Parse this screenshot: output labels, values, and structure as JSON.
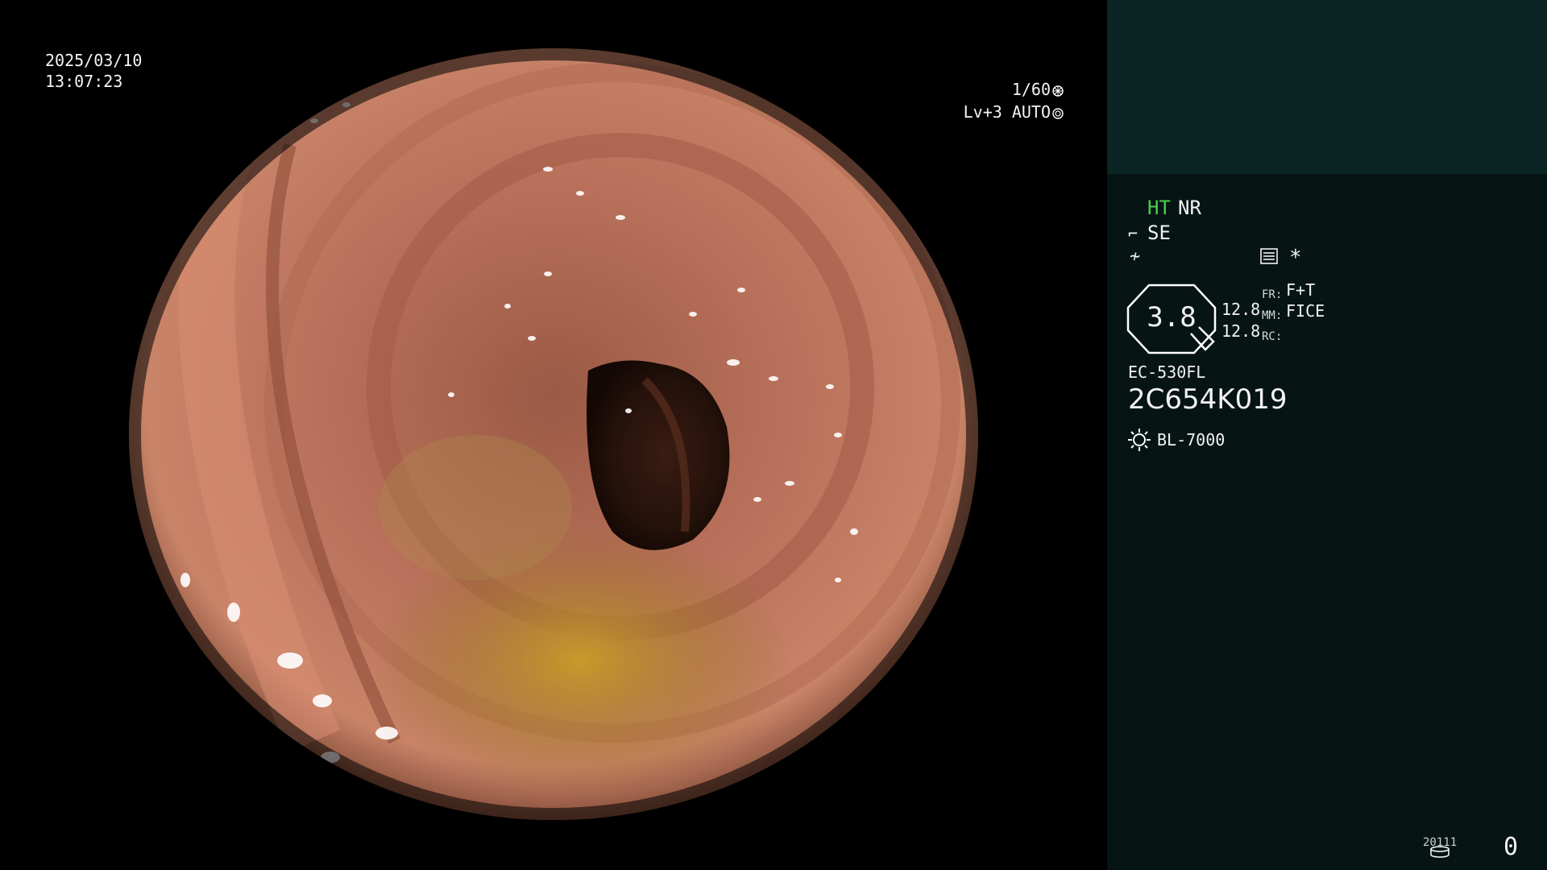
{
  "live": {
    "date": "2025/03/10",
    "time": "13:07:23",
    "shutter": "1/60",
    "level": "Lv+3 AUTO"
  },
  "panel": {
    "ht": "HT",
    "nr": "NR",
    "se": "SE",
    "zoom": "3.8",
    "val1": "12.8",
    "val2": "12.8",
    "fr_label": "FR:",
    "fr_value": "F+T",
    "mm_label": "MM:",
    "mm_value": "FICE",
    "rc_label": "RC:",
    "model": "EC-530FL",
    "serial": "2C654K019",
    "light": "BL-7000",
    "store_code": "20111",
    "store_count": "0",
    "star": "*"
  },
  "icons": {
    "shutter": "aperture-icon",
    "auto": "iris-icon",
    "se": "structure-enhance-icon",
    "struct": "color-enhance-icon",
    "menu": "menu-list-icon",
    "light": "light-source-icon",
    "storage": "storage-icon"
  },
  "colors": {
    "panel_bg": "#071414",
    "preview_bg": "#0b2424",
    "ht_green": "#48d148",
    "mucosa": "#c07a60"
  }
}
